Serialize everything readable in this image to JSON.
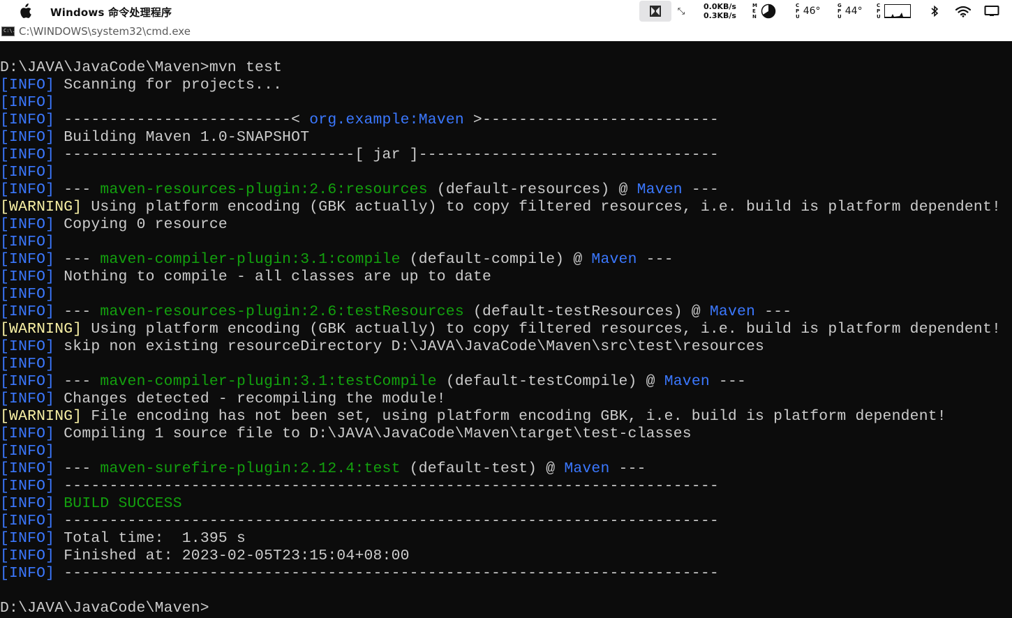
{
  "menubar": {
    "app_title": "Windows 命令处理程序",
    "net_up": "0.0KB/s",
    "net_down": "0.3KB/s",
    "mem_label": [
      "M",
      "E",
      "N"
    ],
    "cpu_label": [
      "C",
      "P",
      "U"
    ],
    "cpu_temp": "46°",
    "gpu_label": [
      "G",
      "P",
      "U"
    ],
    "gpu_temp": "44°",
    "cpu2_label": [
      "C",
      "P",
      "U"
    ]
  },
  "window": {
    "title": "C:\\WINDOWS\\system32\\cmd.exe",
    "icon_text": "C:\\."
  },
  "terminal": {
    "lines": [
      [
        {
          "t": "D:\\JAVA\\JavaCode\\Maven>mvn test",
          "c": "text"
        }
      ],
      [
        {
          "t": "[INFO]",
          "c": "info"
        },
        {
          "t": " Scanning for projects...",
          "c": "text"
        }
      ],
      [
        {
          "t": "[INFO]",
          "c": "info"
        }
      ],
      [
        {
          "t": "[INFO]",
          "c": "info"
        },
        {
          "t": " -------------------------< ",
          "c": "text"
        },
        {
          "t": "org.example:Maven",
          "c": "blue"
        },
        {
          "t": " >--------------------------",
          "c": "text"
        }
      ],
      [
        {
          "t": "[INFO]",
          "c": "info"
        },
        {
          "t": " Building Maven 1.0-SNAPSHOT",
          "c": "text"
        }
      ],
      [
        {
          "t": "[INFO]",
          "c": "info"
        },
        {
          "t": " --------------------------------[ jar ]---------------------------------",
          "c": "text"
        }
      ],
      [
        {
          "t": "[INFO]",
          "c": "info"
        }
      ],
      [
        {
          "t": "[INFO]",
          "c": "info"
        },
        {
          "t": " --- ",
          "c": "text"
        },
        {
          "t": "maven-resources-plugin:2.6:resources",
          "c": "green"
        },
        {
          "t": " (default-resources) @ ",
          "c": "text"
        },
        {
          "t": "Maven",
          "c": "blue"
        },
        {
          "t": " ---",
          "c": "text"
        }
      ],
      [
        {
          "t": "[WARNING]",
          "c": "warn"
        },
        {
          "t": " Using platform encoding (GBK actually) to copy filtered resources, i.e. build is platform dependent!",
          "c": "text"
        }
      ],
      [
        {
          "t": "[INFO]",
          "c": "info"
        },
        {
          "t": " Copying 0 resource",
          "c": "text"
        }
      ],
      [
        {
          "t": "[INFO]",
          "c": "info"
        }
      ],
      [
        {
          "t": "[INFO]",
          "c": "info"
        },
        {
          "t": " --- ",
          "c": "text"
        },
        {
          "t": "maven-compiler-plugin:3.1:compile",
          "c": "green"
        },
        {
          "t": " (default-compile) @ ",
          "c": "text"
        },
        {
          "t": "Maven",
          "c": "blue"
        },
        {
          "t": " ---",
          "c": "text"
        }
      ],
      [
        {
          "t": "[INFO]",
          "c": "info"
        },
        {
          "t": " Nothing to compile - all classes are up to date",
          "c": "text"
        }
      ],
      [
        {
          "t": "[INFO]",
          "c": "info"
        }
      ],
      [
        {
          "t": "[INFO]",
          "c": "info"
        },
        {
          "t": " --- ",
          "c": "text"
        },
        {
          "t": "maven-resources-plugin:2.6:testResources",
          "c": "green"
        },
        {
          "t": " (default-testResources) @ ",
          "c": "text"
        },
        {
          "t": "Maven",
          "c": "blue"
        },
        {
          "t": " ---",
          "c": "text"
        }
      ],
      [
        {
          "t": "[WARNING]",
          "c": "warn"
        },
        {
          "t": " Using platform encoding (GBK actually) to copy filtered resources, i.e. build is platform dependent!",
          "c": "text"
        }
      ],
      [
        {
          "t": "[INFO]",
          "c": "info"
        },
        {
          "t": " skip non existing resourceDirectory D:\\JAVA\\JavaCode\\Maven\\src\\test\\resources",
          "c": "text"
        }
      ],
      [
        {
          "t": "[INFO]",
          "c": "info"
        }
      ],
      [
        {
          "t": "[INFO]",
          "c": "info"
        },
        {
          "t": " --- ",
          "c": "text"
        },
        {
          "t": "maven-compiler-plugin:3.1:testCompile",
          "c": "green"
        },
        {
          "t": " (default-testCompile) @ ",
          "c": "text"
        },
        {
          "t": "Maven",
          "c": "blue"
        },
        {
          "t": " ---",
          "c": "text"
        }
      ],
      [
        {
          "t": "[INFO]",
          "c": "info"
        },
        {
          "t": " Changes detected - recompiling the module!",
          "c": "text"
        }
      ],
      [
        {
          "t": "[WARNING]",
          "c": "warn"
        },
        {
          "t": " File encoding has not been set, using platform encoding GBK, i.e. build is platform dependent!",
          "c": "text"
        }
      ],
      [
        {
          "t": "[INFO]",
          "c": "info"
        },
        {
          "t": " Compiling 1 source file to D:\\JAVA\\JavaCode\\Maven\\target\\test-classes",
          "c": "text"
        }
      ],
      [
        {
          "t": "[INFO]",
          "c": "info"
        }
      ],
      [
        {
          "t": "[INFO]",
          "c": "info"
        },
        {
          "t": " --- ",
          "c": "text"
        },
        {
          "t": "maven-surefire-plugin:2.12.4:test",
          "c": "green"
        },
        {
          "t": " (default-test) @ ",
          "c": "text"
        },
        {
          "t": "Maven",
          "c": "blue"
        },
        {
          "t": " ---",
          "c": "text"
        }
      ],
      [
        {
          "t": "[INFO]",
          "c": "info"
        },
        {
          "t": " ------------------------------------------------------------------------",
          "c": "text"
        }
      ],
      [
        {
          "t": "[INFO]",
          "c": "info"
        },
        {
          "t": " BUILD SUCCESS",
          "c": "green"
        }
      ],
      [
        {
          "t": "[INFO]",
          "c": "info"
        },
        {
          "t": " ------------------------------------------------------------------------",
          "c": "text"
        }
      ],
      [
        {
          "t": "[INFO]",
          "c": "info"
        },
        {
          "t": " Total time:  1.395 s",
          "c": "text"
        }
      ],
      [
        {
          "t": "[INFO]",
          "c": "info"
        },
        {
          "t": " Finished at: 2023-02-05T23:15:04+08:00",
          "c": "text"
        }
      ],
      [
        {
          "t": "[INFO]",
          "c": "info"
        },
        {
          "t": " ------------------------------------------------------------------------",
          "c": "text"
        }
      ],
      [],
      [
        {
          "t": "D:\\JAVA\\JavaCode\\Maven>",
          "c": "text"
        }
      ]
    ]
  }
}
